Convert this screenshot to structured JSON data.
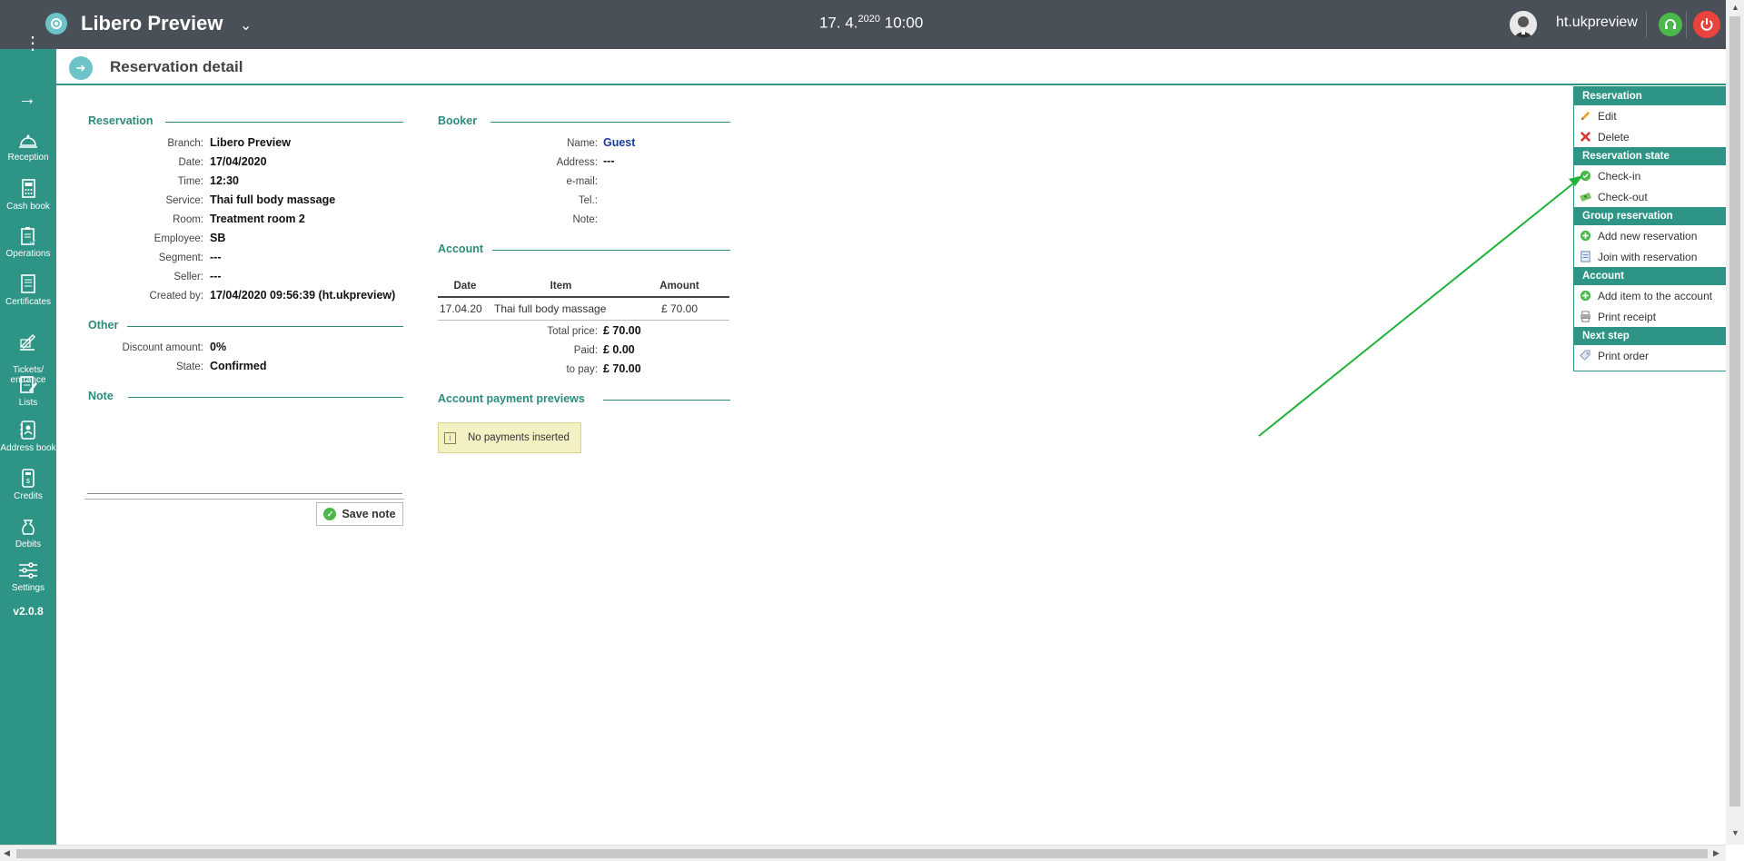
{
  "header": {
    "app_title": "Libero Preview",
    "date": "17. 4.",
    "year": "2020",
    "time": "10:00",
    "username": "ht.ukpreview"
  },
  "sidebar": {
    "items": [
      {
        "label": "Reception",
        "icon": "bell-icon"
      },
      {
        "label": "Cash book",
        "icon": "calculator-icon"
      },
      {
        "label": "Operations",
        "icon": "clipboard-icon"
      },
      {
        "label": "Certificates",
        "icon": "certificate-icon"
      },
      {
        "label": "Tickets/\nentrance",
        "icon": "ticket-icon"
      },
      {
        "label": "Lists",
        "icon": "list-icon"
      },
      {
        "label": "Address book",
        "icon": "address-book-icon"
      },
      {
        "label": "Credits",
        "icon": "credit-icon"
      },
      {
        "label": "Debits",
        "icon": "debit-icon"
      },
      {
        "label": "Settings",
        "icon": "sliders-icon"
      }
    ],
    "version": "v2.0.8"
  },
  "page": {
    "title": "Reservation detail"
  },
  "reservation": {
    "title": "Reservation",
    "fields": [
      {
        "label": "Branch:",
        "value": "Libero Preview"
      },
      {
        "label": "Date:",
        "value": "17/04/2020"
      },
      {
        "label": "Time:",
        "value": "12:30"
      },
      {
        "label": "Service:",
        "value": "Thai full body massage"
      },
      {
        "label": "Room:",
        "value": "Treatment room 2"
      },
      {
        "label": "Employee:",
        "value": "SB"
      },
      {
        "label": "Segment:",
        "value": "---"
      },
      {
        "label": "Seller:",
        "value": "---"
      },
      {
        "label": "Created by:",
        "value": "17/04/2020 09:56:39 (ht.ukpreview)"
      }
    ]
  },
  "other": {
    "title": "Other",
    "fields": [
      {
        "label": "Discount amount:",
        "value": "0%"
      },
      {
        "label": "State:",
        "value": "Confirmed"
      }
    ]
  },
  "note": {
    "title": "Note",
    "value": "",
    "save_label": "Save note"
  },
  "booker": {
    "title": "Booker",
    "fields": [
      {
        "label": "Name:",
        "value": "Guest"
      },
      {
        "label": "Address:",
        "value": "---"
      },
      {
        "label": "e-mail:",
        "value": ""
      },
      {
        "label": "Tel.:",
        "value": ""
      },
      {
        "label": "Note:",
        "value": ""
      }
    ]
  },
  "account": {
    "title": "Account",
    "columns": [
      "Date",
      "Item",
      "Amount"
    ],
    "rows": [
      {
        "date": "17.04.20",
        "item": "Thai full body massage",
        "amount": "£ 70.00"
      }
    ],
    "totals": [
      {
        "label": "Total price:",
        "value": "£ 70.00"
      },
      {
        "label": "Paid:",
        "value": "£ 0.00"
      },
      {
        "label": "to pay:",
        "value": "£ 70.00"
      }
    ]
  },
  "payments": {
    "title": "Account payment previews",
    "empty_text": "No payments inserted"
  },
  "actions": {
    "reservation_head": "Reservation",
    "edit": "Edit",
    "delete": "Delete",
    "state_head": "Reservation state",
    "checkin": "Check-in",
    "checkout": "Check-out",
    "group_head": "Group reservation",
    "add_new": "Add new reservation",
    "join": "Join with reservation",
    "account_head": "Account",
    "add_item": "Add item to the account",
    "print_receipt": "Print receipt",
    "next_head": "Next step",
    "print_order": "Print order"
  },
  "colors": {
    "accent": "#2e9486",
    "topbar": "#4a5058",
    "annotation_arrow": "#1fb33a"
  }
}
